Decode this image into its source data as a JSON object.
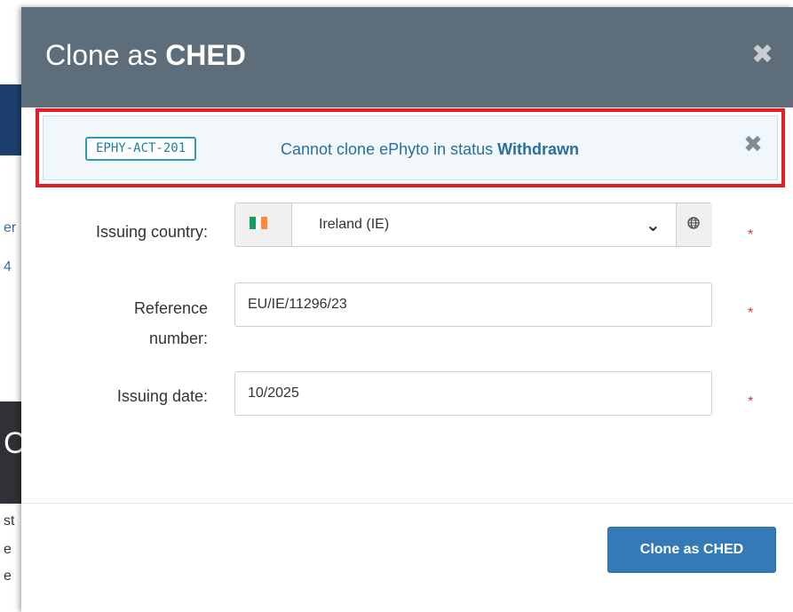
{
  "background": {
    "fragments": [
      "er",
      "4",
      "C",
      "st",
      "e",
      "e"
    ]
  },
  "modal": {
    "title_prefix": "Clone as ",
    "title_bold": "CHED",
    "close_label": "✖"
  },
  "alert": {
    "code": "EPHY-ACT-201",
    "message_prefix": "Cannot clone ePhyto in status ",
    "message_status": "Withdrawn",
    "close_label": "✖"
  },
  "form": {
    "issuing_country": {
      "label": "Issuing country:",
      "value": "Ireland (IE)",
      "flag_colors": [
        "#169b62",
        "#ffffff",
        "#ff883e"
      ],
      "required_mark": "*"
    },
    "reference_number": {
      "label_line1": "Reference",
      "label_line2": "number:",
      "value": "EU/IE/11296/23",
      "required_mark": "*"
    },
    "issuing_date": {
      "label": "Issuing date:",
      "value": "10/2025",
      "required_mark": "*"
    }
  },
  "footer": {
    "submit_label": "Clone as CHED"
  },
  "colors": {
    "header_bg": "#5d6e7a",
    "highlight_border": "#e41e26",
    "alert_bg": "#f2f7fb",
    "primary": "#337ab7",
    "required": "#d23b3b"
  }
}
